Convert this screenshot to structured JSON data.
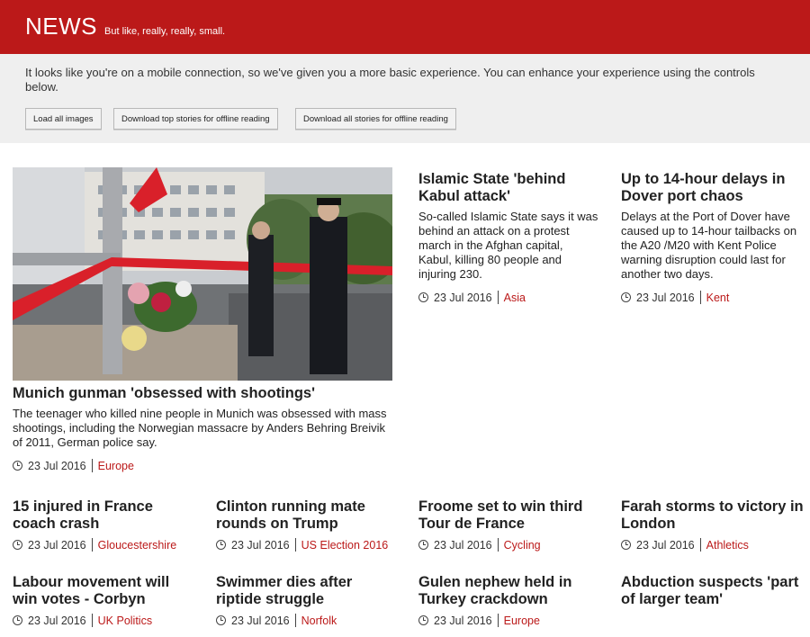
{
  "masthead": {
    "logo": "NEWS",
    "tagline": "But like, really, really, small."
  },
  "notice": {
    "text": "It looks like you're on a mobile connection, so we've given you a more basic experience. You can enhance your experience using the controls below.",
    "buttons": [
      "Load all images",
      "Download top stories for offline reading",
      "Download all stories for offline reading"
    ]
  },
  "accent_color": "#bb1919",
  "stories": [
    {
      "title": "Munich gunman 'obsessed with shootings'",
      "summary": "The teenager who killed nine people in Munich was obsessed with mass shootings, including the Norwegian massacre by Anders Behring Breivik of 2011, German police say.",
      "date": "23 Jul 2016",
      "tag": "Europe"
    },
    {
      "title": "Islamic State 'behind Kabul attack'",
      "summary": "So-called Islamic State says it was behind an attack on a protest march in the Afghan capital, Kabul, killing 80 people and injuring 230.",
      "date": "23 Jul 2016",
      "tag": "Asia"
    },
    {
      "title": "Up to 14-hour delays in Dover port chaos",
      "summary": "Delays at the Port of Dover have caused up to 14-hour tailbacks on the A20 /M20 with Kent Police warning disruption could last for another two days.",
      "date": "23 Jul 2016",
      "tag": "Kent"
    },
    {
      "title": "15 injured in France coach crash",
      "date": "23 Jul 2016",
      "tag": "Gloucestershire"
    },
    {
      "title": "Clinton running mate rounds on Trump",
      "date": "23 Jul 2016",
      "tag": "US Election 2016"
    },
    {
      "title": "Froome set to win third Tour de France",
      "date": "23 Jul 2016",
      "tag": "Cycling"
    },
    {
      "title": "Farah storms to victory in London",
      "date": "23 Jul 2016",
      "tag": "Athletics"
    },
    {
      "title": "Labour movement will win votes - Corbyn",
      "date": "23 Jul 2016",
      "tag": "UK Politics"
    },
    {
      "title": "Swimmer dies after riptide struggle",
      "date": "23 Jul 2016",
      "tag": "Norfolk"
    },
    {
      "title": "Gulen nephew held in Turkey crackdown",
      "date": "23 Jul 2016",
      "tag": "Europe"
    },
    {
      "title": "Abduction suspects 'part of larger team'"
    }
  ]
}
